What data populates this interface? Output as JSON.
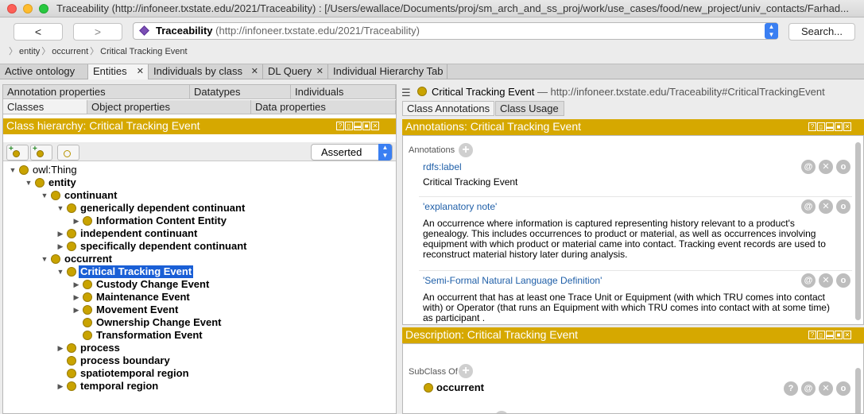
{
  "window": {
    "title": "Traceability (http://infoneer.txstate.edu/2021/Traceability)  : [/Users/ewallace/Documents/proj/sm_arch_and_ss_proj/work/use_cases/food/new_project/univ_contacts/Farhad..."
  },
  "nav": {
    "back": "<",
    "forward": ">",
    "ontology_name": "Traceability",
    "ontology_iri": "(http://infoneer.txstate.edu/2021/Traceability)",
    "search": "Search..."
  },
  "breadcrumb": [
    "entity",
    "occurrent",
    "Critical Tracking Event"
  ],
  "tabs": [
    {
      "label": "Active ontology",
      "closable": false
    },
    {
      "label": "Entities",
      "closable": true,
      "active": true
    },
    {
      "label": "Individuals by class",
      "closable": true
    },
    {
      "label": "DL Query",
      "closable": true
    },
    {
      "label": "Individual Hierarchy Tab",
      "closable": false
    }
  ],
  "left": {
    "subtabs_row1": [
      "Annotation properties",
      "Datatypes",
      "Individuals"
    ],
    "subtabs_row2": [
      "Classes",
      "Object properties",
      "Data properties"
    ],
    "view_title": "Class hierarchy: Critical Tracking Event",
    "view_buttons": [
      "?",
      "▯",
      "▬",
      "■",
      "✕"
    ],
    "mode": "Asserted",
    "tree": [
      {
        "label": "owl:Thing",
        "depth": 0,
        "toggle": "open",
        "bold": false
      },
      {
        "label": "entity",
        "depth": 1,
        "toggle": "open",
        "bold": true
      },
      {
        "label": "continuant",
        "depth": 2,
        "toggle": "open",
        "bold": true
      },
      {
        "label": "generically dependent continuant",
        "depth": 3,
        "toggle": "open",
        "bold": true
      },
      {
        "label": "Information Content Entity",
        "depth": 4,
        "toggle": "closed",
        "bold": true
      },
      {
        "label": "independent continuant",
        "depth": 3,
        "toggle": "closed",
        "bold": true
      },
      {
        "label": "specifically dependent continuant",
        "depth": 3,
        "toggle": "closed",
        "bold": true
      },
      {
        "label": "occurrent",
        "depth": 2,
        "toggle": "open",
        "bold": true
      },
      {
        "label": "Critical Tracking Event",
        "depth": 3,
        "toggle": "open",
        "bold": true,
        "selected": true
      },
      {
        "label": "Custody Change Event",
        "depth": 4,
        "toggle": "closed",
        "bold": true
      },
      {
        "label": "Maintenance Event",
        "depth": 4,
        "toggle": "closed",
        "bold": true
      },
      {
        "label": "Movement Event",
        "depth": 4,
        "toggle": "closed",
        "bold": true
      },
      {
        "label": "Ownership Change Event",
        "depth": 4,
        "toggle": "none",
        "bold": true
      },
      {
        "label": "Transformation Event",
        "depth": 4,
        "toggle": "none",
        "bold": true
      },
      {
        "label": "process",
        "depth": 3,
        "toggle": "closed",
        "bold": true
      },
      {
        "label": "process boundary",
        "depth": 3,
        "toggle": "none",
        "bold": true
      },
      {
        "label": "spatiotemporal region",
        "depth": 3,
        "toggle": "none",
        "bold": true
      },
      {
        "label": "temporal region",
        "depth": 3,
        "toggle": "closed",
        "bold": true
      }
    ]
  },
  "right": {
    "entity_name": "Critical Tracking Event",
    "entity_iri": " — http://infoneer.txstate.edu/Traceability#CriticalTrackingEvent",
    "tabs": [
      "Class Annotations",
      "Class Usage"
    ],
    "annotations_title": "Annotations: Critical Tracking Event",
    "annotations_label": "Annotations",
    "annotations": [
      {
        "property": "rdfs:label",
        "value": "Critical Tracking Event"
      },
      {
        "property": "'explanatory note'",
        "value": "An occurrence where information is captured representing history relevant to a product's genealogy.  This includes occurrences to product or material, as well as occurrences involving equipment with which product or material came into contact.  Tracking event records are used to reconstruct material history later during analysis."
      },
      {
        "property": "'Semi-Formal Natural Language Definition'",
        "value": "An occurrent that has at least one Trace Unit or Equipment (with which TRU comes into contact with) or Operator (that runs an Equipment with which TRU comes into contact with at some time) as participant ."
      }
    ],
    "description_title": "Description: Critical Tracking Event",
    "subclass_label": "SubClass Of",
    "superclass": "occurrent"
  },
  "colors": {
    "view_header": "#d6a800",
    "class_dot": "#c9a300",
    "selection": "#1a5fd6",
    "annotation_property": "#1f5fa8"
  }
}
